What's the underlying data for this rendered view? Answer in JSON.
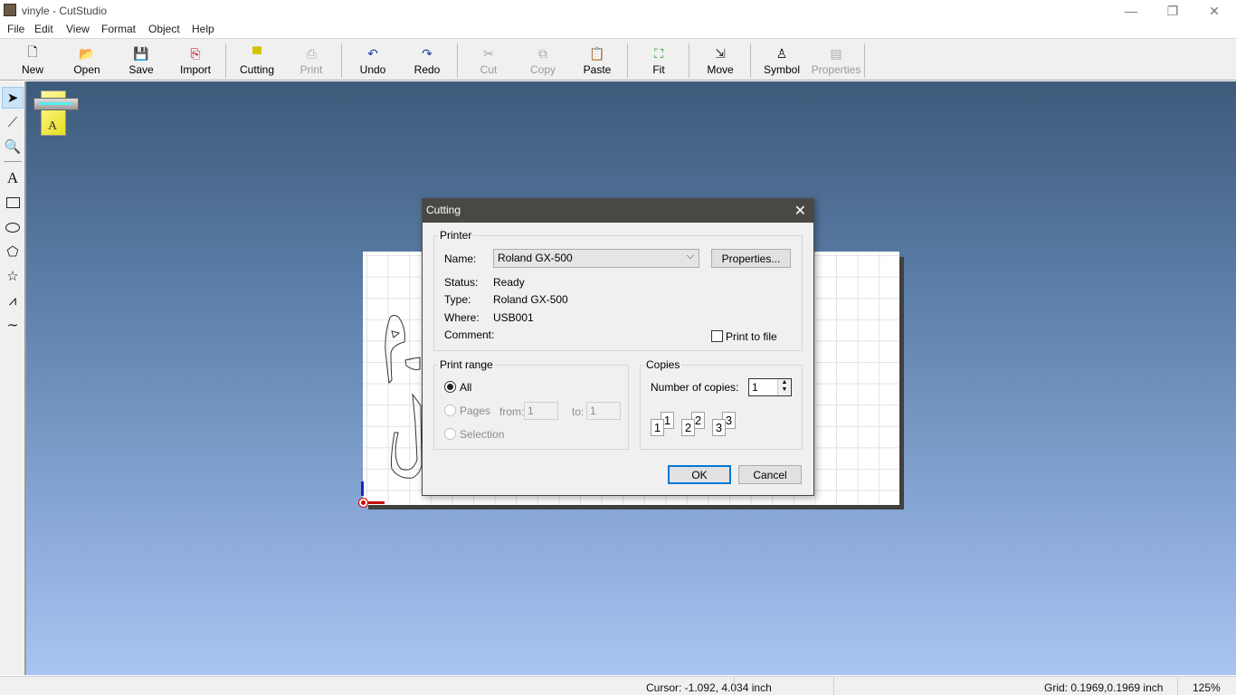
{
  "window": {
    "title": "vinyle - CutStudio",
    "minimize_icon": "minimize-icon",
    "restore_icon": "restore-icon",
    "close_icon": "close-icon"
  },
  "menu": [
    {
      "label": "File"
    },
    {
      "label": "Edit"
    },
    {
      "label": "View"
    },
    {
      "label": "Format"
    },
    {
      "label": "Object"
    },
    {
      "label": "Help"
    }
  ],
  "toolbar": [
    {
      "label": "New",
      "icon": "new-document-icon",
      "enabled": true
    },
    {
      "label": "Open",
      "icon": "open-folder-icon",
      "enabled": true
    },
    {
      "label": "Save",
      "icon": "save-disk-icon",
      "enabled": true
    },
    {
      "label": "Import",
      "icon": "import-icon",
      "enabled": true
    },
    {
      "label": "Cutting",
      "icon": "cutting-printer-icon",
      "enabled": true
    },
    {
      "label": "Print",
      "icon": "print-icon",
      "enabled": false
    },
    {
      "label": "Undo",
      "icon": "undo-icon",
      "enabled": true
    },
    {
      "label": "Redo",
      "icon": "redo-icon",
      "enabled": true
    },
    {
      "label": "Cut",
      "icon": "scissors-icon",
      "enabled": false
    },
    {
      "label": "Copy",
      "icon": "copy-icon",
      "enabled": false
    },
    {
      "label": "Paste",
      "icon": "paste-icon",
      "enabled": true
    },
    {
      "label": "Fit",
      "icon": "fit-icon",
      "enabled": true
    },
    {
      "label": "Move",
      "icon": "move-origin-icon",
      "enabled": true
    },
    {
      "label": "Symbol",
      "icon": "symbol-person-icon",
      "enabled": true
    },
    {
      "label": "Properties",
      "icon": "properties-icon",
      "enabled": false
    }
  ],
  "tools": [
    {
      "name": "select-tool",
      "icon": "arrow-pointer-icon",
      "selected": true
    },
    {
      "name": "edit-points-tool",
      "icon": "node-edit-icon"
    },
    {
      "name": "zoom-tool",
      "icon": "magnifier-icon"
    },
    {
      "name": "text-tool",
      "icon": "text-a-icon"
    },
    {
      "name": "rectangle-tool",
      "icon": "rectangle-icon"
    },
    {
      "name": "ellipse-tool",
      "icon": "ellipse-icon"
    },
    {
      "name": "polygon-tool",
      "icon": "pentagon-icon"
    },
    {
      "name": "star-tool",
      "icon": "star-icon"
    },
    {
      "name": "polyline-tool",
      "icon": "polyline-icon"
    },
    {
      "name": "curve-tool",
      "icon": "curve-icon"
    }
  ],
  "dialog": {
    "title": "Cutting",
    "printer_group": "Printer",
    "name_label": "Name:",
    "name_value": "Roland GX-500",
    "properties_button": "Properties...",
    "status_label": "Status:",
    "status_value": "Ready",
    "type_label": "Type:",
    "type_value": "Roland GX-500",
    "where_label": "Where:",
    "where_value": "USB001",
    "comment_label": "Comment:",
    "comment_value": "",
    "print_to_file_label": "Print to file",
    "print_to_file_checked": false,
    "range_group": "Print range",
    "range_all": "All",
    "range_pages": "Pages",
    "range_selection": "Selection",
    "range_selected": "All",
    "from_label": "from:",
    "from_value": "1",
    "to_label": "to:",
    "to_value": "1",
    "copies_group": "Copies",
    "copies_label": "Number of copies:",
    "copies_value": "1",
    "collate_pages": [
      "1",
      "1",
      "2",
      "2",
      "3",
      "3"
    ],
    "ok_button": "OK",
    "cancel_button": "Cancel"
  },
  "status": {
    "cursor": "Cursor: -1.092, 4.034 inch",
    "grid": "Grid: 0.1969,0.1969 inch",
    "zoom": "125%"
  }
}
